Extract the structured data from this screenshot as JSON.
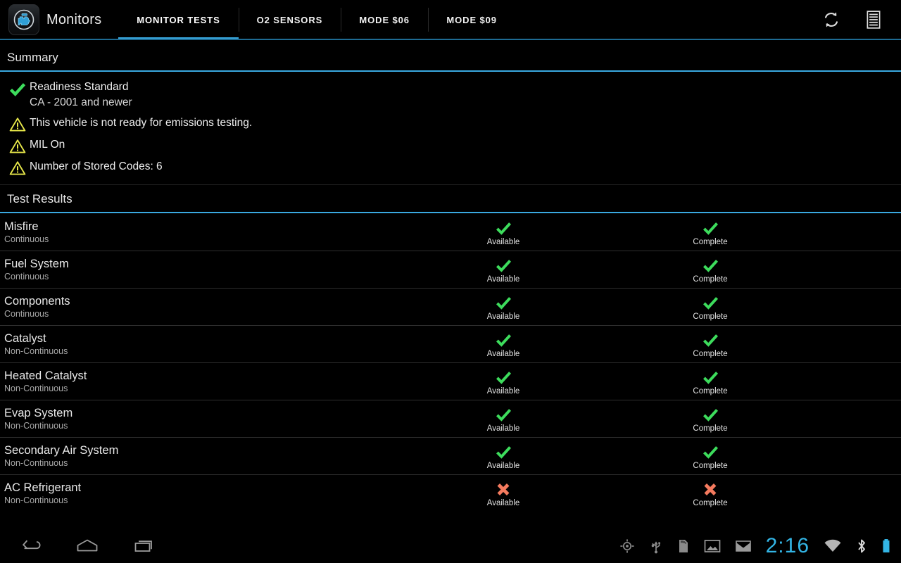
{
  "app": {
    "title": "Monitors",
    "icon": "check-engine-icon"
  },
  "tabs": [
    {
      "label": "MONITOR TESTS",
      "active": true
    },
    {
      "label": "O2 SENSORS",
      "active": false
    },
    {
      "label": "MODE $06",
      "active": false
    },
    {
      "label": "MODE $09",
      "active": false
    }
  ],
  "actions": [
    {
      "name": "refresh-icon",
      "label": "Refresh"
    },
    {
      "name": "list-view-icon",
      "label": "List"
    }
  ],
  "summary": {
    "header": "Summary",
    "items": [
      {
        "icon": "check-icon",
        "status": "ok",
        "line1": "Readiness Standard",
        "line2": "CA - 2001 and newer"
      },
      {
        "icon": "warning-icon",
        "status": "warn",
        "line1": "This vehicle is not ready for emissions testing.",
        "line2": ""
      },
      {
        "icon": "warning-icon",
        "status": "warn",
        "line1": "MIL On",
        "line2": ""
      },
      {
        "icon": "warning-icon",
        "status": "warn",
        "line1": "Number of Stored Codes: 6",
        "line2": ""
      }
    ]
  },
  "results": {
    "header": "Test Results",
    "rows": [
      {
        "name": "Misfire",
        "type": "Continuous",
        "available_label": "Available",
        "available_state": "pass",
        "complete_label": "Complete",
        "complete_state": "pass"
      },
      {
        "name": "Fuel System",
        "type": "Continuous",
        "available_label": "Available",
        "available_state": "pass",
        "complete_label": "Complete",
        "complete_state": "pass"
      },
      {
        "name": "Components",
        "type": "Continuous",
        "available_label": "Available",
        "available_state": "pass",
        "complete_label": "Complete",
        "complete_state": "pass"
      },
      {
        "name": "Catalyst",
        "type": "Non-Continuous",
        "available_label": "Available",
        "available_state": "pass",
        "complete_label": "Complete",
        "complete_state": "pass"
      },
      {
        "name": "Heated Catalyst",
        "type": "Non-Continuous",
        "available_label": "Available",
        "available_state": "pass",
        "complete_label": "Complete",
        "complete_state": "pass"
      },
      {
        "name": "Evap System",
        "type": "Non-Continuous",
        "available_label": "Available",
        "available_state": "pass",
        "complete_label": "Complete",
        "complete_state": "pass"
      },
      {
        "name": "Secondary Air System",
        "type": "Non-Continuous",
        "available_label": "Available",
        "available_state": "pass",
        "complete_label": "Complete",
        "complete_state": "pass"
      },
      {
        "name": "AC Refrigerant",
        "type": "Non-Continuous",
        "available_label": "Available",
        "available_state": "fail",
        "complete_label": "Complete",
        "complete_state": "fail"
      }
    ]
  },
  "navbar": {
    "buttons": [
      {
        "name": "back-icon",
        "label": "Back"
      },
      {
        "name": "home-icon",
        "label": "Home"
      },
      {
        "name": "recents-icon",
        "label": "Recent apps"
      }
    ],
    "tray": [
      {
        "name": "location-icon",
        "label": "GPS"
      },
      {
        "name": "usb-icon",
        "label": "USB"
      },
      {
        "name": "sd-card-icon",
        "label": "SD card"
      },
      {
        "name": "image-icon",
        "label": "Screenshot"
      },
      {
        "name": "gmail-icon",
        "label": "Gmail"
      }
    ],
    "clock": "2:16",
    "status": [
      {
        "name": "wifi-icon",
        "label": "Wi-Fi"
      },
      {
        "name": "bluetooth-icon",
        "label": "Bluetooth"
      },
      {
        "name": "battery-icon",
        "label": "Battery"
      }
    ]
  },
  "colors": {
    "accent_blue": "#3aa9e0",
    "pass_green": "#3ddc5c",
    "fail_red": "#f47a5e",
    "warn_yellow": "#e8e84a",
    "clock_blue": "#33b5e5",
    "background": "#000000"
  }
}
